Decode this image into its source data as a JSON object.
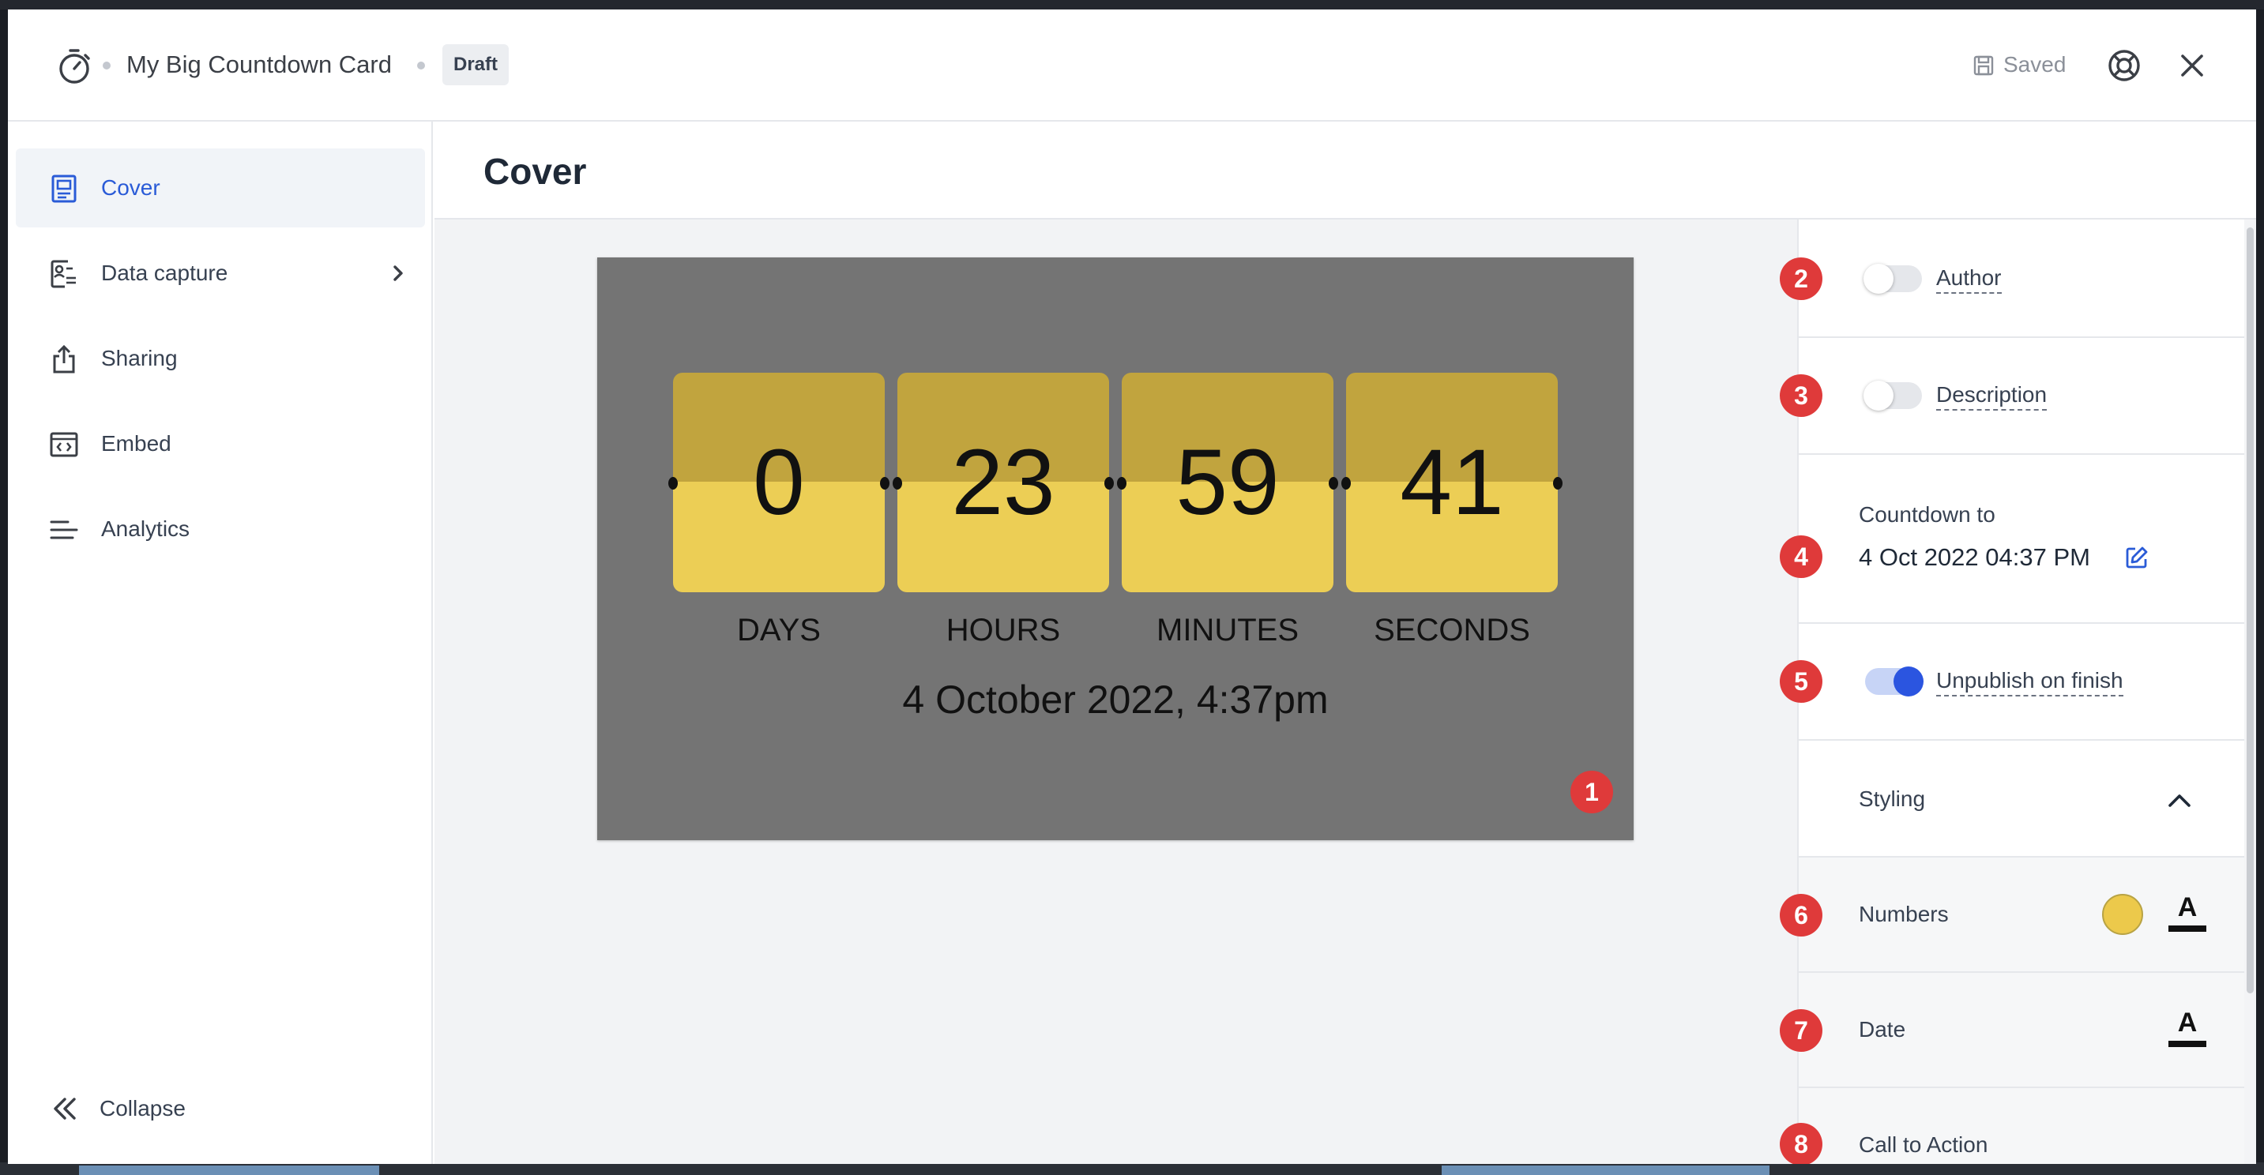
{
  "header": {
    "title": "My Big Countdown Card",
    "badge": "Draft",
    "saved_label": "Saved",
    "icons": [
      "stopwatch-icon",
      "save-icon",
      "lifebuoy-icon",
      "close-icon"
    ]
  },
  "sidebar": {
    "items": [
      {
        "label": "Cover",
        "icon": "cover-icon",
        "active": true
      },
      {
        "label": "Data capture",
        "icon": "data-capture-icon",
        "has_submenu": true
      },
      {
        "label": "Sharing",
        "icon": "share-icon"
      },
      {
        "label": "Embed",
        "icon": "embed-icon"
      },
      {
        "label": "Analytics",
        "icon": "analytics-icon"
      }
    ],
    "collapse_label": "Collapse"
  },
  "main": {
    "title": "Cover"
  },
  "card": {
    "units": [
      {
        "value": "0",
        "label": "DAYS"
      },
      {
        "value": "23",
        "label": "HOURS"
      },
      {
        "value": "59",
        "label": "MINUTES"
      },
      {
        "value": "41",
        "label": "SECONDS"
      }
    ],
    "date_text": "4 October 2022, 4:37pm",
    "background_color": "#747474",
    "number_color": "#ecce55"
  },
  "markers": [
    "1",
    "2",
    "3",
    "4",
    "5",
    "6",
    "7",
    "8"
  ],
  "panel": {
    "author_label": "Author",
    "author_enabled": false,
    "description_label": "Description",
    "description_enabled": false,
    "countdown_label": "Countdown to",
    "countdown_value": "4 Oct 2022 04:37 PM",
    "unpublish_label": "Unpublish on finish",
    "unpublish_enabled": true,
    "styling_label": "Styling",
    "numbers_label": "Numbers",
    "numbers_swatch": "#ecc94b",
    "date_label": "Date",
    "cta_label": "Call to Action",
    "text_style_glyph": "A"
  },
  "colors": {
    "accent": "#2a5bd7",
    "toggle_on": "#2b55e0",
    "marker": "#df3a3a"
  }
}
